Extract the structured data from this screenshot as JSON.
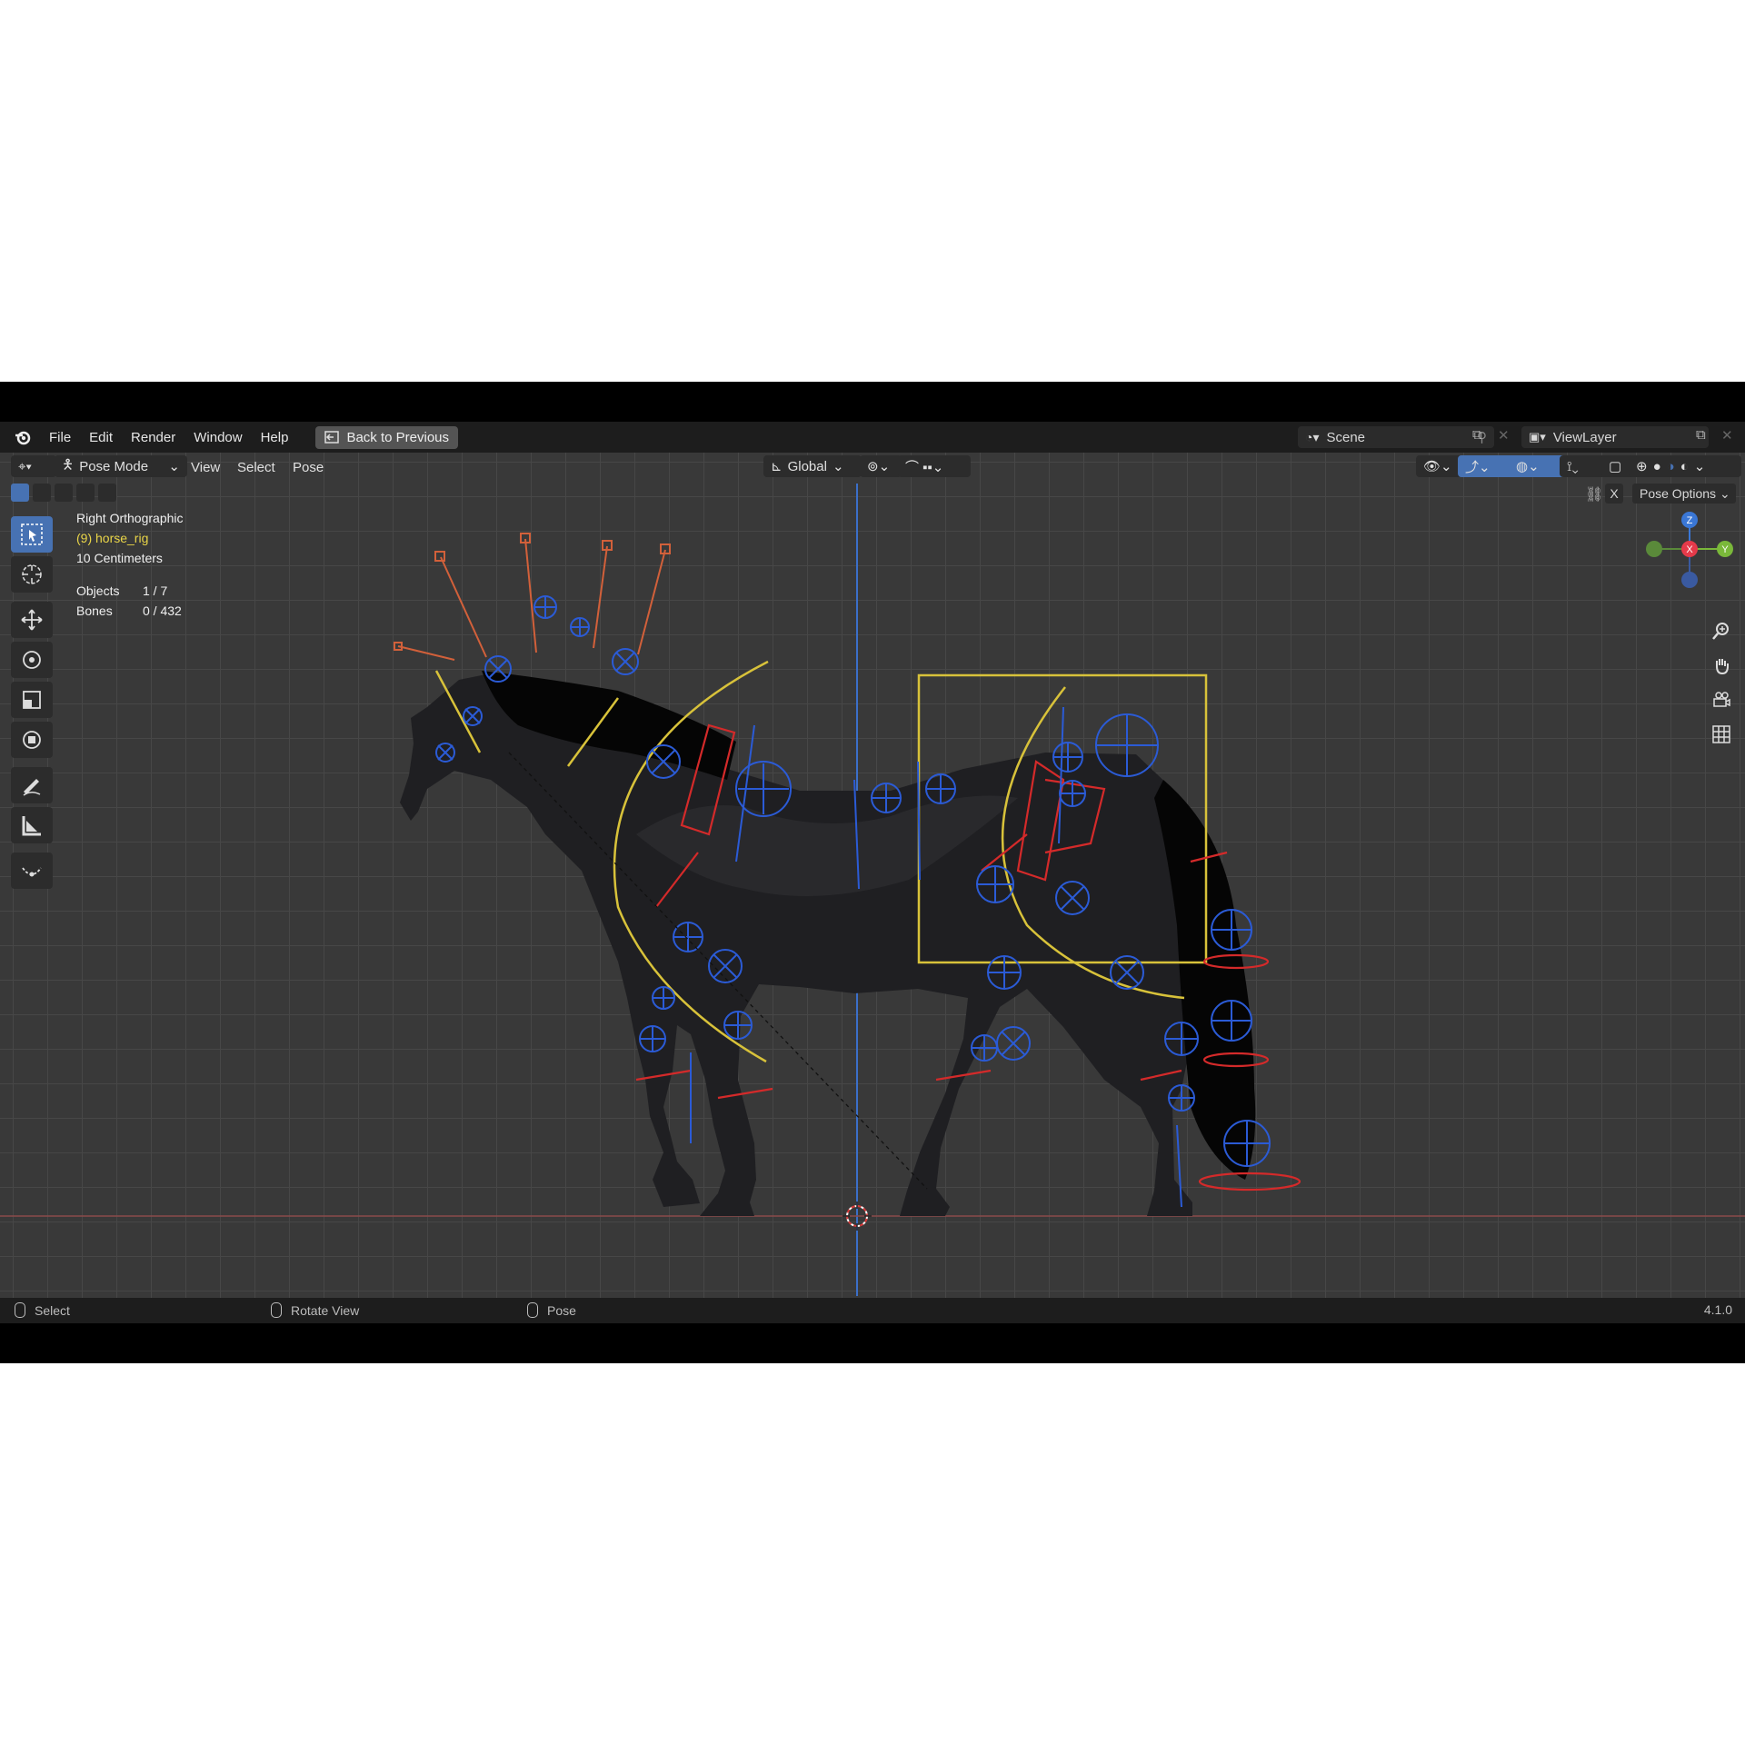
{
  "menubar": {
    "items": [
      "File",
      "Edit",
      "Render",
      "Window",
      "Help"
    ],
    "back_button": "Back to Previous",
    "scene": "Scene",
    "view_layer": "ViewLayer"
  },
  "header": {
    "mode": "Pose Mode",
    "menus": [
      "View",
      "Select",
      "Pose"
    ],
    "orientation": "Global",
    "pose_options": "Pose Options",
    "x_label": "X"
  },
  "viewport_info": {
    "view": "Right Orthographic",
    "object": "(9) horse_rig",
    "scale": "10 Centimeters",
    "objects_label": "Objects",
    "objects_value": "1 / 7",
    "bones_label": "Bones",
    "bones_value": "0 / 432"
  },
  "gizmo": {
    "z": "Z",
    "x": "X",
    "y": "Y"
  },
  "statusbar": {
    "select": "Select",
    "rotate": "Rotate View",
    "pose": "Pose",
    "version": "4.1.0"
  },
  "colors": {
    "accent": "#4772b3",
    "bone_blue": "#2b5bd6",
    "bone_yellow": "#d8c23a",
    "bone_red": "#d42a2a",
    "bone_orange": "#d2603a"
  }
}
